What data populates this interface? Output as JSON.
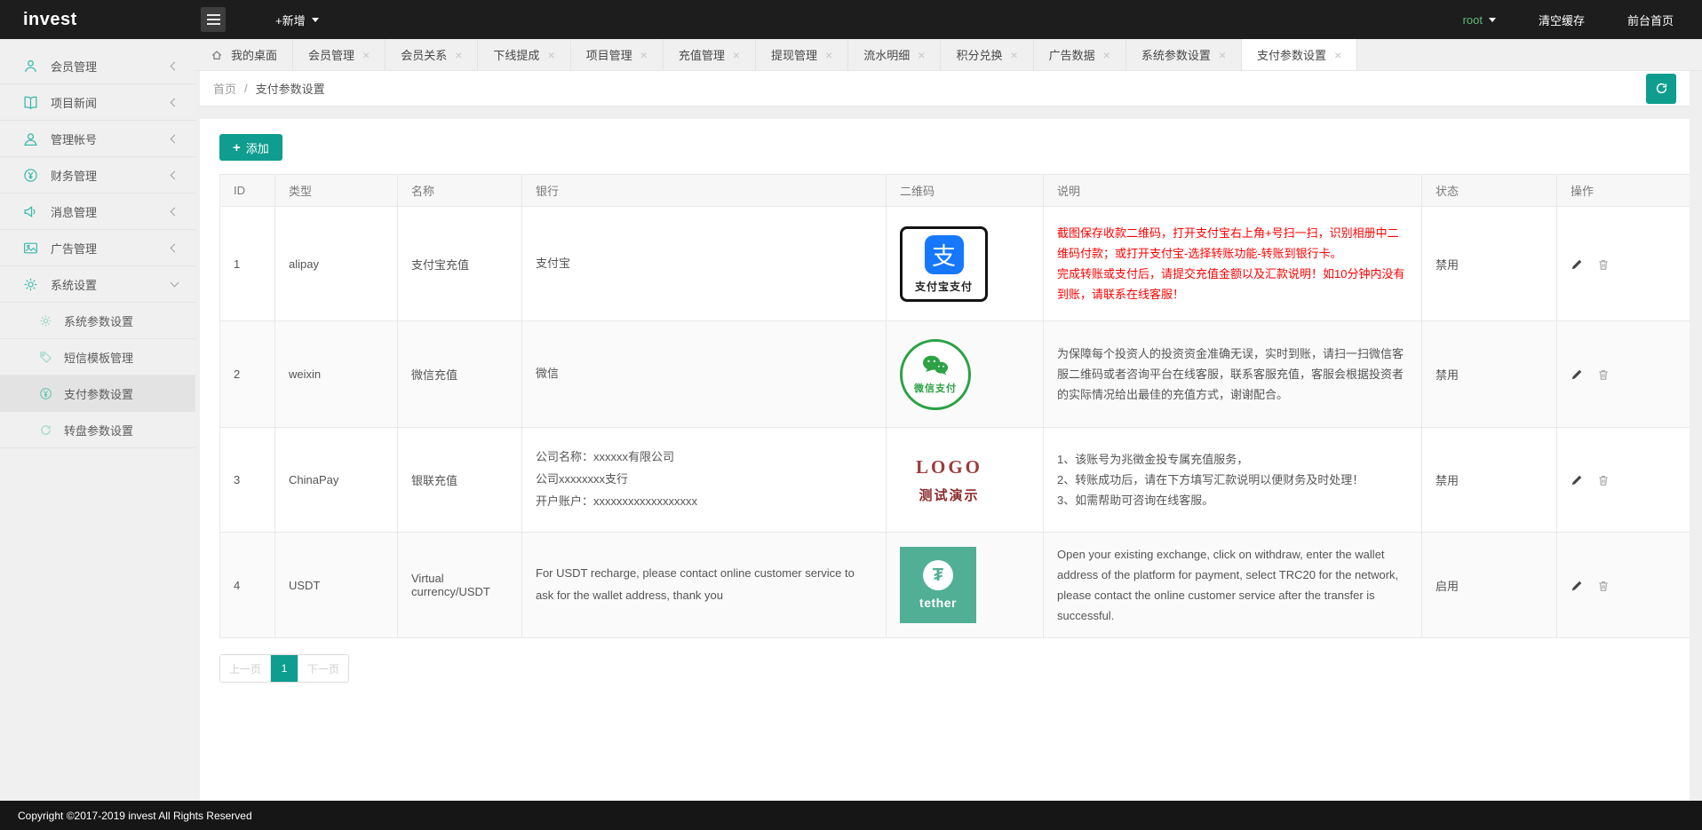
{
  "app": {
    "logo": "invest",
    "footer": "Copyright ©2017-2019 invest All Rights Reserved"
  },
  "glyphs": {
    "close": "×",
    "plus": "+",
    "crumb_separator": "/"
  },
  "colors": {
    "accent_teal": "#0e9d8e",
    "sidebar_icon_teal": "#3cb8a8",
    "notice_red": "#ff0000",
    "alipay_blue": "#1678ff",
    "wechat_green": "#2ba245",
    "tether_teal": "#50af95",
    "logo_dark_red": "#9b3c3c",
    "root_green": "#5fb878"
  },
  "header": {
    "new_button": "+新增",
    "user": "root",
    "clear_cache": "清空缓存",
    "front_home": "前台首页"
  },
  "sidebar": {
    "items": [
      {
        "label": "会员管理"
      },
      {
        "label": "项目新闻"
      },
      {
        "label": "管理帐号"
      },
      {
        "label": "财务管理"
      },
      {
        "label": "消息管理"
      },
      {
        "label": "广告管理"
      },
      {
        "label": "系统设置"
      }
    ],
    "sub_items": [
      {
        "label": "系统参数设置"
      },
      {
        "label": "短信模板管理"
      },
      {
        "label": "支付参数设置"
      },
      {
        "label": "转盘参数设置"
      }
    ]
  },
  "tabs": [
    {
      "label": "我的桌面"
    },
    {
      "label": "会员管理"
    },
    {
      "label": "会员关系"
    },
    {
      "label": "下线提成"
    },
    {
      "label": "项目管理"
    },
    {
      "label": "充值管理"
    },
    {
      "label": "提现管理"
    },
    {
      "label": "流水明细"
    },
    {
      "label": "积分兑换"
    },
    {
      "label": "广告数据"
    },
    {
      "label": "系统参数设置"
    },
    {
      "label": "支付参数设置"
    }
  ],
  "breadcrumb": {
    "home": "首页",
    "current": "支付参数设置"
  },
  "toolbar": {
    "add_label": "添加"
  },
  "table": {
    "headers": [
      "ID",
      "类型",
      "名称",
      "银行",
      "二维码",
      "说明",
      "状态",
      "操作"
    ],
    "rows": [
      {
        "id": "1",
        "type": "alipay",
        "name": "支付宝充值",
        "bank_lines": [
          "支付宝"
        ],
        "qr": {
          "logo_char": "支",
          "label": "支付宝支付"
        },
        "desc_lines": [
          "截图保存收款二维码，打开支付宝右上角+号扫一扫，识别相册中二维码付款；或打开支付宝-选择转账功能-转账到银行卡。",
          "完成转账或支付后，请提交充值金额以及汇款说明！如10分钟内没有到账，请联系在线客服！"
        ],
        "status": "禁用"
      },
      {
        "id": "2",
        "type": "weixin",
        "name": "微信充值",
        "bank_lines": [
          "微信"
        ],
        "qr": {
          "label": "微信支付"
        },
        "desc_lines": [
          "为保障每个投资人的投资资金准确无误，实时到账，请扫一扫微信客服二维码或者咨询平台在线客服，联系客服充值，客服会根据投资者的实际情况给出最佳的充值方式，谢谢配合。"
        ],
        "status": "禁用"
      },
      {
        "id": "3",
        "type": "ChinaPay",
        "name": "银联充值",
        "bank_lines": [
          "公司名称：xxxxxx有限公司",
          "公司xxxxxxxx支行",
          "开户账户：xxxxxxxxxxxxxxxxxx"
        ],
        "qr": {
          "line1": "LOGO",
          "line2": "测试演示"
        },
        "desc_lines": [
          "1、该账号为兆徵金投专属充值服务，",
          "2、转账成功后，请在下方填写汇款说明以便财务及时处理！",
          "3、如需帮助可咨询在线客服。"
        ],
        "status": "禁用"
      },
      {
        "id": "4",
        "type": "USDT",
        "name": "Virtual currency/USDT",
        "bank_lines": [
          "For USDT recharge, please contact online customer service to ask for the wallet address, thank you"
        ],
        "qr": {
          "symbol": "₮",
          "label": "tether"
        },
        "desc_lines": [
          "Open your existing exchange, click on withdraw, enter the wallet address of the platform for payment, select TRC20 for the network, please contact the online customer service after the transfer is successful."
        ],
        "status": "启用"
      }
    ]
  },
  "pagination": {
    "prev": "上一页",
    "current": "1",
    "next": "下一页"
  }
}
